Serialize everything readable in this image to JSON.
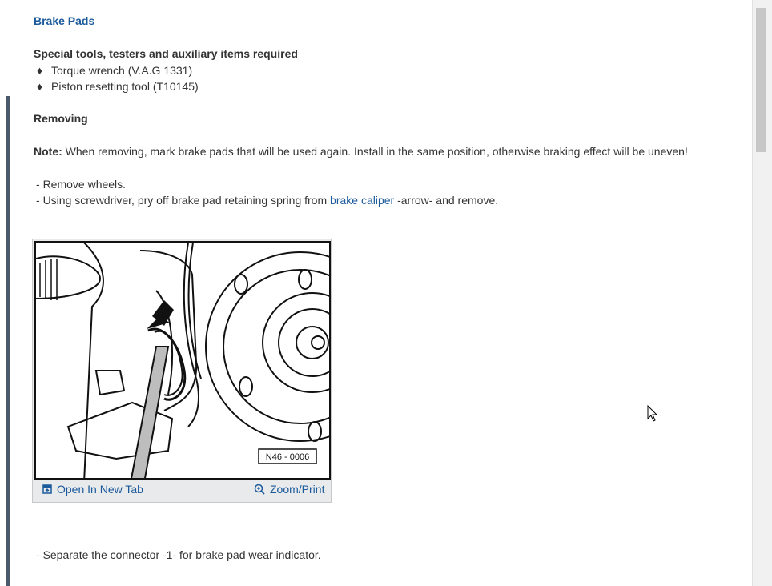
{
  "title": "Brake Pads",
  "tools": {
    "heading": "Special tools, testers and auxiliary items required",
    "bullet_glyph": "♦",
    "items": [
      "Torque wrench (V.A.G 1331)",
      "Piston resetting tool (T10145)"
    ]
  },
  "removing": {
    "heading": "Removing",
    "note_label": "Note:",
    "note_text": " When removing, mark brake pads that will be used again. Install in the same position, otherwise braking effect will be uneven!",
    "steps": [
      {
        "prefix": "-  ",
        "text": "Remove wheels."
      },
      {
        "prefix": "-  ",
        "before": "Using screwdriver, pry off brake pad retaining spring from ",
        "link": "brake caliper",
        "after": " -arrow- and remove."
      }
    ]
  },
  "figure": {
    "label": "N46 - 0006",
    "open_tab_label": "Open In New Tab",
    "open_tab_icon": "open-tab-icon",
    "zoom_label": "Zoom/Print",
    "zoom_icon": "magnifier-icon"
  },
  "step3": {
    "prefix": "-  ",
    "text": "Separate the connector -1- for brake pad wear indicator."
  },
  "colors": {
    "link": "#1b5a9b",
    "text": "#333333"
  }
}
